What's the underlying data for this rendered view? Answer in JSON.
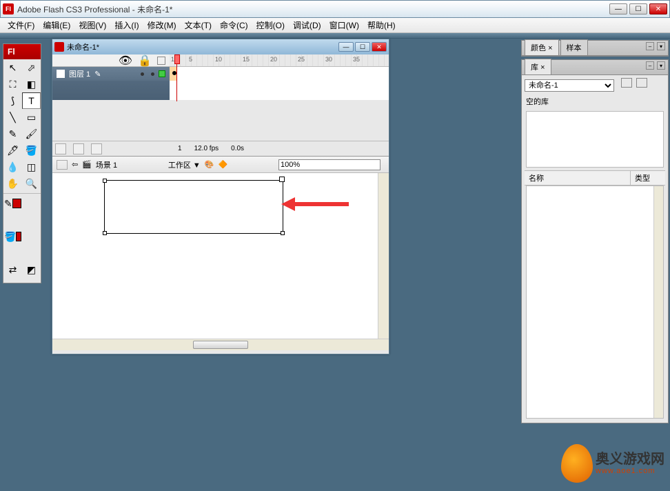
{
  "app": {
    "title": "Adobe Flash CS3 Professional - 未命名-1*",
    "logo_text": "Fl"
  },
  "menu": {
    "file": "文件(F)",
    "edit": "编辑(E)",
    "view": "视图(V)",
    "insert": "插入(I)",
    "modify": "修改(M)",
    "text": "文本(T)",
    "commands": "命令(C)",
    "control": "控制(O)",
    "debug": "调试(D)",
    "window": "窗口(W)",
    "help": "帮助(H)"
  },
  "tools": {
    "header": "Fl",
    "items": [
      "selection",
      "subselect",
      "free-transform",
      "gradient-transform",
      "lasso",
      "text",
      "line",
      "rect",
      "pencil",
      "brush",
      "ink",
      "paint-bucket",
      "eyedrop",
      "eraser",
      "hand",
      "zoom"
    ],
    "stroke_color": "#000000",
    "fill_color": "#cc0000"
  },
  "document": {
    "tab_title": "未命名-1*",
    "layer_name": "图层 1",
    "scene_label": "场景 1",
    "workarea_label": "工作区 ▼",
    "zoom": "100%",
    "ruler_marks": [
      "1",
      "5",
      "10",
      "15",
      "20",
      "25",
      "30",
      "35"
    ]
  },
  "timeline_status": {
    "frame": "1",
    "fps": "12.0 fps",
    "time": "0.0s"
  },
  "panels": {
    "color_tab": "颜色",
    "swatch_tab": "样本",
    "library_tab": "库",
    "library_doc": "未命名-1",
    "library_status": "空的库",
    "col_name": "名称",
    "col_type": "类型"
  },
  "watermark": {
    "text": "奥义游戏网",
    "url": "www.aoe1.com"
  }
}
